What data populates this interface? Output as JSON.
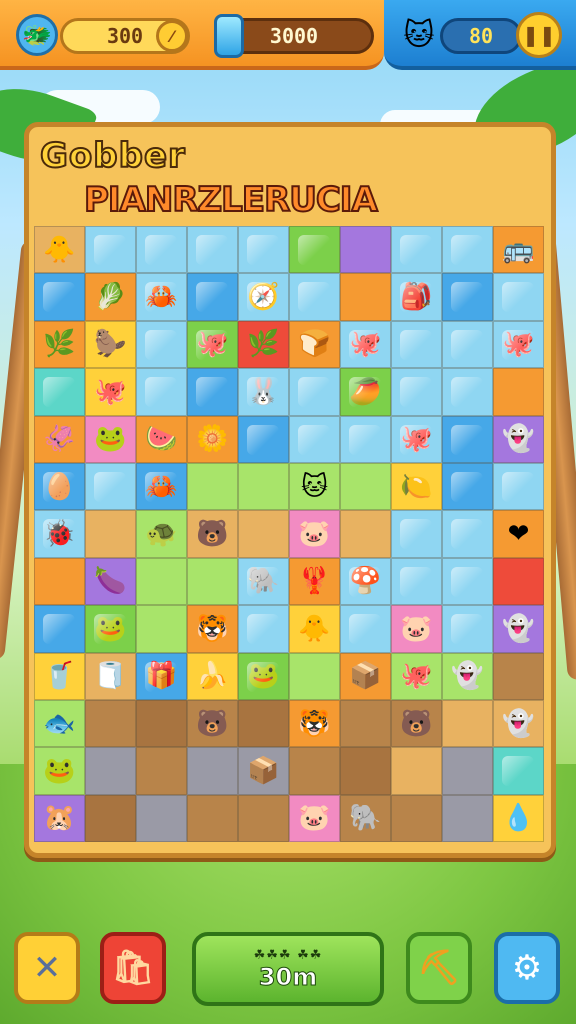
{
  "hud": {
    "coins": "300",
    "gems": "3000",
    "stars": "80",
    "avatar_icon": "monster-avatar-icon",
    "coin_icon": "coin-icon",
    "gem_icon": "gem-icon",
    "cat_icon": "cat-icon",
    "pause_icon": "pause-icon",
    "coin_glyph": "⁄"
  },
  "title": {
    "line1": "Gobber",
    "line2": "PIANRZLERUCIA"
  },
  "board": {
    "rows": [
      [
        "sand",
        "ltblue",
        "ltblue",
        "ltblue",
        "ltblue",
        "green",
        "purple",
        "ltblue",
        "ltblue",
        "orange"
      ],
      [
        "blue",
        "orange",
        "ltblue",
        "blue",
        "ltblue",
        "ltblue",
        "orange",
        "ltblue",
        "blue",
        "ltblue"
      ],
      [
        "orange",
        "yellow",
        "ltblue",
        "green",
        "red",
        "orange",
        "ltblue",
        "ltblue",
        "ltblue",
        "ltblue"
      ],
      [
        "teal",
        "yellow",
        "ltblue",
        "blue",
        "ltblue",
        "ltblue",
        "green",
        "ltblue",
        "ltblue",
        "orange"
      ],
      [
        "orange",
        "pink",
        "orange",
        "orange",
        "blue",
        "ltblue",
        "ltblue",
        "ltblue",
        "blue",
        "purple"
      ],
      [
        "blue",
        "ltblue",
        "blue",
        "ltgreen",
        "ltgreen",
        "ltgreen",
        "ltgreen",
        "yellow",
        "blue",
        "ltblue"
      ],
      [
        "ltblue",
        "sand",
        "ltgreen",
        "sand",
        "sand",
        "pink",
        "sand",
        "ltblue",
        "ltblue",
        "orange"
      ],
      [
        "orange",
        "purple",
        "ltgreen",
        "ltgreen",
        "ltblue",
        "orange",
        "ltblue",
        "ltblue",
        "ltblue",
        "red"
      ],
      [
        "blue",
        "green",
        "ltgreen",
        "orange",
        "ltblue",
        "yellow",
        "ltblue",
        "pink",
        "ltblue",
        "purple"
      ],
      [
        "yellow",
        "sand",
        "blue",
        "yellow",
        "green",
        "ltgreen",
        "orange",
        "ltgreen",
        "ltgreen",
        "dirt"
      ],
      [
        "ltgreen",
        "dirt",
        "dirt2",
        "dirt",
        "dirt2",
        "orange",
        "dirt",
        "dirt",
        "sand",
        "sand"
      ],
      [
        "ltgreen",
        "stone",
        "dirt",
        "stone",
        "stone",
        "dirt",
        "dirt2",
        "sand",
        "stone",
        "teal"
      ],
      [
        "purple",
        "dirt2",
        "stone",
        "dirt",
        "dirt",
        "pink",
        "dirt",
        "dirt",
        "stone",
        "yellow"
      ]
    ],
    "pieces": [
      [
        "🐥",
        "",
        "",
        "",
        "",
        "",
        "",
        "",
        "",
        "🚌"
      ],
      [
        "",
        "🥬",
        "🦀",
        "",
        "🧭",
        "",
        "",
        "🎒",
        "",
        ""
      ],
      [
        "🌿",
        "🦫",
        "",
        "🐙",
        "🌿",
        "🍞",
        "🐙",
        "",
        "",
        "🐙"
      ],
      [
        "",
        "🐙",
        "",
        "",
        "🐰",
        "",
        "🥭",
        "",
        "",
        ""
      ],
      [
        "🦑",
        "🐸",
        "🍉",
        "🌼",
        "",
        "",
        "",
        "🐙",
        "",
        "👻"
      ],
      [
        "🥚",
        "",
        "🦀",
        "",
        "",
        "🐱",
        "",
        "🍋",
        "",
        ""
      ],
      [
        "🐞",
        "",
        "🐢",
        "🐻",
        "",
        "🐷",
        "",
        "",
        "",
        "❤"
      ],
      [
        "",
        "🍆",
        "",
        "",
        "🐘",
        "🦞",
        "🍄",
        "",
        "",
        ""
      ],
      [
        "",
        "🐸",
        "",
        "🐯",
        "",
        "🐥",
        "",
        "🐷",
        "",
        "👻"
      ],
      [
        "🥤",
        "🧻",
        "🎁",
        "🍌",
        "🐸",
        "",
        "📦",
        "🐙",
        "👻",
        ""
      ],
      [
        "🐟",
        "",
        "",
        "🐻",
        "",
        "🐯",
        "",
        "🐻",
        "",
        "👻"
      ],
      [
        "🐸",
        "",
        "",
        "",
        "📦",
        "",
        "",
        "",
        "",
        ""
      ],
      [
        "🐹",
        "",
        "",
        "",
        "",
        "🐷",
        "🐘",
        "",
        "",
        "💧"
      ]
    ]
  },
  "bottom": {
    "close_icon": "close-icon",
    "bag_icon": "bag-icon",
    "pickaxe_icon": "pickaxe-icon",
    "gear_icon": "gear-icon",
    "main_label": "☘☘☘ ☘☘",
    "main_value": "30m",
    "close_glyph": "✕",
    "bag_glyph": "🛍",
    "pick_glyph": "⛏",
    "gear_glyph": "⚙"
  }
}
